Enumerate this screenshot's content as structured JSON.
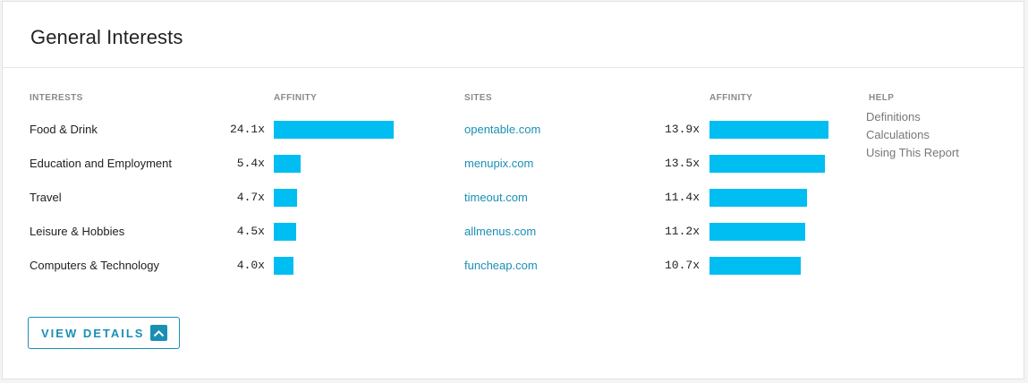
{
  "title": "General Interests",
  "headers": {
    "interests": "INTERESTS",
    "affinity_interests": "AFFINITY",
    "sites": "SITES",
    "affinity_sites": "AFFINITY",
    "help": "HELP"
  },
  "interests": [
    {
      "label": "Food & Drink",
      "affinity": "24.1x",
      "value": 24.1
    },
    {
      "label": "Education and Employment",
      "affinity": "5.4x",
      "value": 5.4
    },
    {
      "label": "Travel",
      "affinity": "4.7x",
      "value": 4.7
    },
    {
      "label": "Leisure & Hobbies",
      "affinity": "4.5x",
      "value": 4.5
    },
    {
      "label": "Computers & Technology",
      "affinity": "4.0x",
      "value": 4.0
    }
  ],
  "sites": [
    {
      "label": "opentable.com",
      "affinity": "13.9x",
      "value": 13.9
    },
    {
      "label": "menupix.com",
      "affinity": "13.5x",
      "value": 13.5
    },
    {
      "label": "timeout.com",
      "affinity": "11.4x",
      "value": 11.4
    },
    {
      "label": "allmenus.com",
      "affinity": "11.2x",
      "value": 11.2
    },
    {
      "label": "funcheap.com",
      "affinity": "10.7x",
      "value": 10.7
    }
  ],
  "help_links": [
    "Definitions",
    "Calculations",
    "Using This Report"
  ],
  "view_details_label": "VIEW DETAILS",
  "colors": {
    "bar": "#00bdf2",
    "link": "#1a8fb5",
    "header_text": "#8a8a8a"
  },
  "icons": {
    "view_details": "chevron-up-icon"
  }
}
